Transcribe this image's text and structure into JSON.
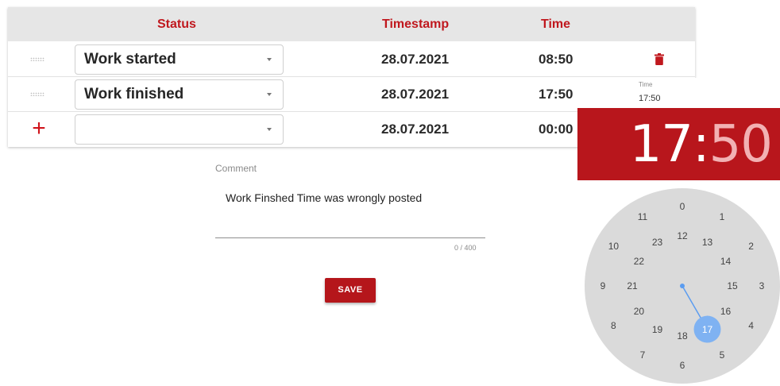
{
  "table": {
    "headers": {
      "status": "Status",
      "timestamp": "Timestamp",
      "time": "Time"
    },
    "rows": [
      {
        "status": "Work started",
        "timestamp": "28.07.2021",
        "time": "08:50"
      },
      {
        "status": "Work finished",
        "timestamp": "28.07.2021",
        "time": "17:50"
      },
      {
        "status": "",
        "timestamp": "28.07.2021",
        "time": "00:00"
      }
    ]
  },
  "comment": {
    "label": "Comment",
    "value": "Work Finshed Time was wrongly posted",
    "counter": "0 / 400"
  },
  "save_label": "SAVE",
  "time_picker": {
    "label": "Time",
    "value": "17:50",
    "hours_display": "17",
    "separator": ":",
    "minutes_display": "50",
    "selected_hour": "17",
    "outer_hours": [
      "0",
      "1",
      "2",
      "3",
      "4",
      "5",
      "6",
      "7",
      "8",
      "9",
      "10",
      "11"
    ],
    "inner_hours": [
      "12",
      "13",
      "14",
      "15",
      "16",
      "17",
      "18",
      "19",
      "20",
      "21",
      "22",
      "23"
    ]
  },
  "colors": {
    "accent": "#c0181e",
    "header_bg": "#e6e6e6",
    "clock_face": "#dadada",
    "clock_hand": "#5b9cf0"
  },
  "icons": {
    "drag": "drag-handle-icon",
    "add": "plus-icon",
    "delete": "trash-icon",
    "dropdown": "caret-down-icon"
  }
}
